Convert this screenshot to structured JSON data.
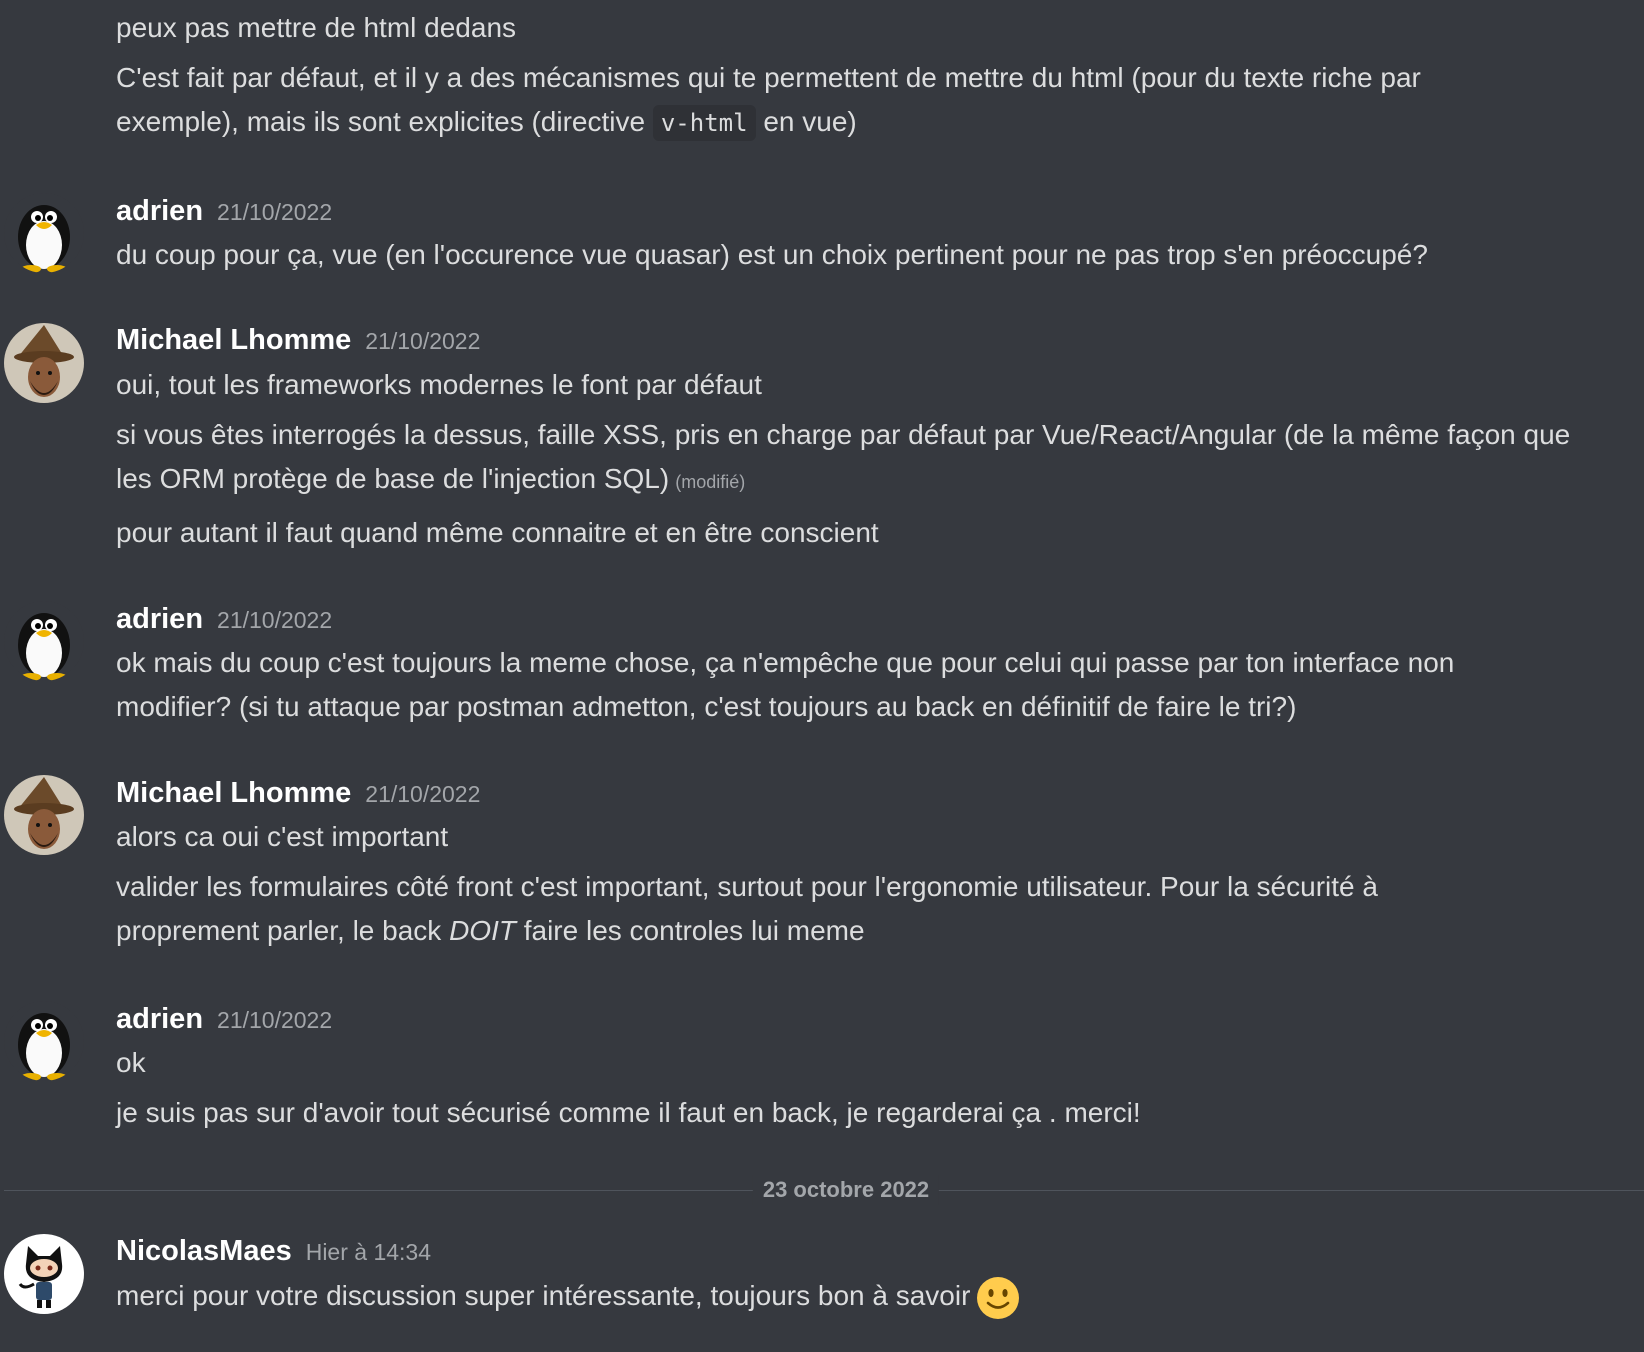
{
  "messages": {
    "top": {
      "line1": "peux pas mettre de html dedans",
      "line2_pre": "C'est fait par défaut, et il y a des mécanismes qui te permettent de mettre du html (pour du texte riche par exemple), mais ils sont explicites (directive ",
      "line2_code": "v-html",
      "line2_post": " en vue)"
    },
    "g1": {
      "author": "adrien",
      "time": "21/10/2022",
      "line1": "du coup pour ça, vue (en l'occurence vue quasar) est un choix pertinent pour ne pas trop s'en préoccupé?"
    },
    "g2": {
      "author": "Michael Lhomme",
      "time": "21/10/2022",
      "line1": "oui, tout les frameworks modernes le font par défaut",
      "line2": "si vous êtes interrogés la dessus, faille XSS, pris en charge par défaut par Vue/React/Angular (de la même façon que les ORM protège de base de l'injection SQL)",
      "edited": "(modifié)",
      "line3": "pour autant il faut quand même connaitre et en être conscient"
    },
    "g3": {
      "author": "adrien",
      "time": "21/10/2022",
      "line1": "ok mais du coup c'est toujours la meme chose, ça n'empêche que pour celui qui passe par ton interface non modifier? (si tu attaque par postman admetton, c'est toujours au back en définitif de faire le tri?)"
    },
    "g4": {
      "author": "Michael Lhomme",
      "time": "21/10/2022",
      "line1": "alors ca oui c'est important",
      "line2_pre": "valider les formulaires côté front c'est important, surtout pour l'ergonomie utilisateur. Pour la sécurité à proprement parler, le back ",
      "line2_em": "DOIT",
      "line2_post": " faire les controles lui meme"
    },
    "g5": {
      "author": "adrien",
      "time": "21/10/2022",
      "line1": "ok",
      "line2": "je suis pas sur d'avoir tout sécurisé comme il faut en back, je regarderai ça . merci!"
    },
    "divider": "23 octobre 2022",
    "g6": {
      "author": "NicolasMaes",
      "time": "Hier à 14:34",
      "line1": "merci pour votre discussion super intéressante, toujours bon à savoir",
      "emoji": "slightly-smiling-face-emoji"
    }
  },
  "icons": {
    "penguin": "tux-avatar-icon",
    "wizard": "wizard-hat-avatar-icon",
    "octocat": "octocat-avatar-icon"
  },
  "colors": {
    "background": "#36393f",
    "text": "#dcddde",
    "author": "#ffffff",
    "muted": "#a3a6aa"
  }
}
